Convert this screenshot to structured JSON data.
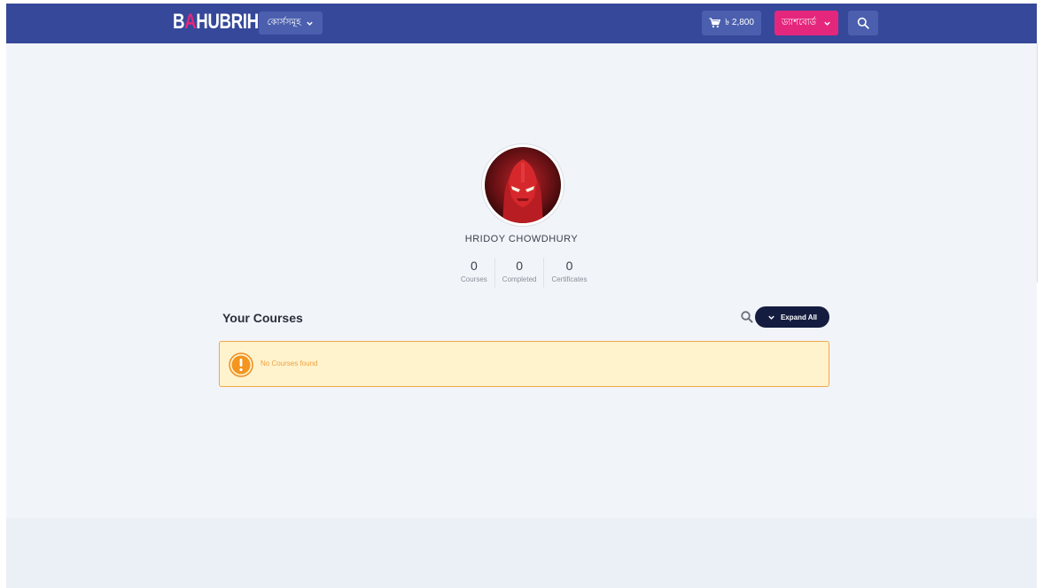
{
  "header": {
    "logo_text_before": "B",
    "logo_text_accent": "A",
    "logo_text_after": "HUBRIHI",
    "courses_menu_label": "কোর্সসমূহ",
    "cart_amount": "৳ 2,800",
    "dashboard_label": "ড্যাশবোর্ড"
  },
  "profile": {
    "name": "HRIDOY CHOWDHURY",
    "stats": [
      {
        "value": "0",
        "label": "Courses"
      },
      {
        "value": "0",
        "label": "Completed"
      },
      {
        "value": "0",
        "label": "Certificates"
      }
    ]
  },
  "courses": {
    "title": "Your Courses",
    "expand_label": "Expand All",
    "empty_message": "No Courses found"
  },
  "colors": {
    "navbar": "#35489a",
    "brand_pink": "#e5267d",
    "expand_button": "#141c3f",
    "alert_bg": "#fff3cd",
    "alert_border": "#f3a64a"
  },
  "icons": {
    "cart": "cart-icon",
    "search": "search-icon",
    "chevron": "chevron-down-icon",
    "alert": "exclamation-icon"
  }
}
